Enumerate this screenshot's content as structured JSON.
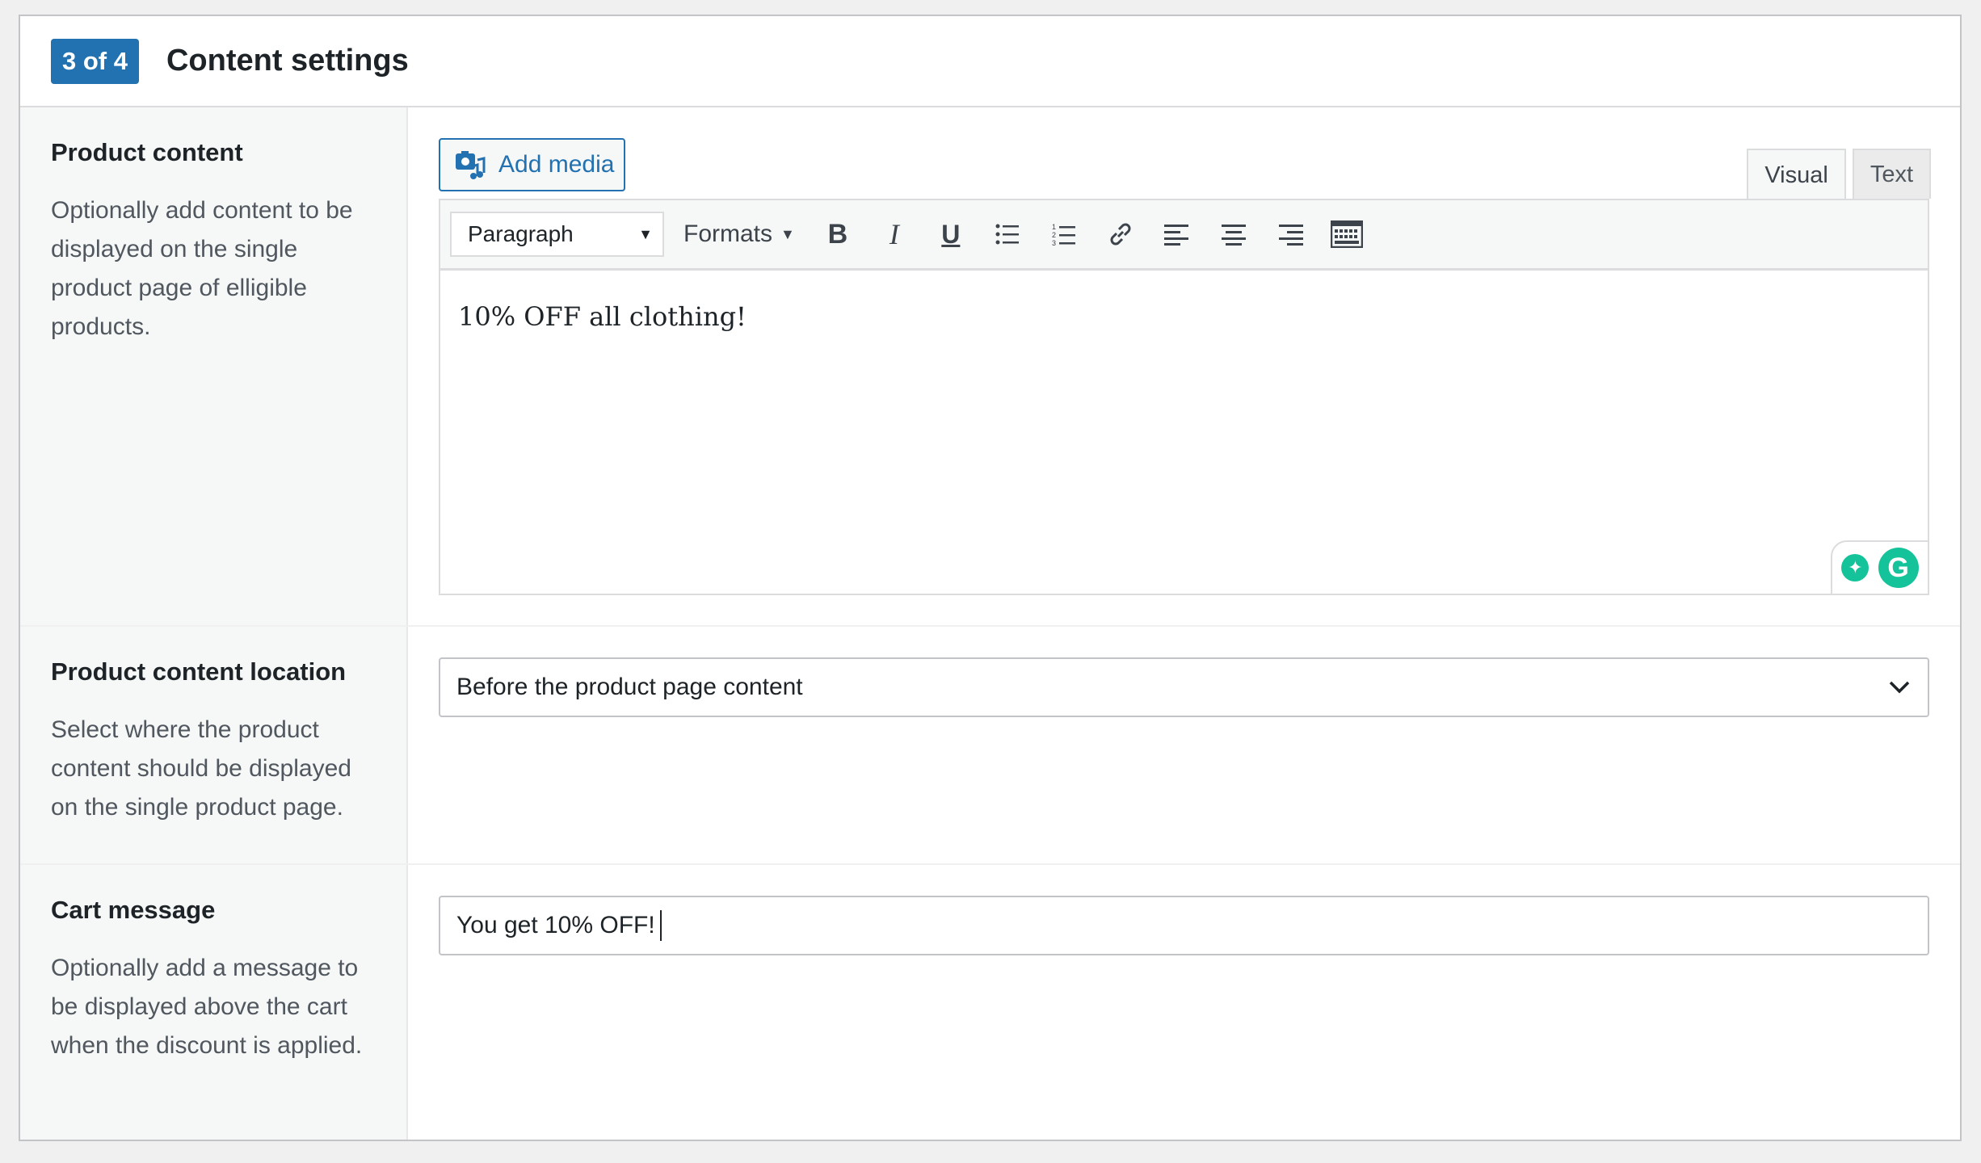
{
  "header": {
    "step_badge": "3 of 4",
    "title": "Content settings"
  },
  "product_content": {
    "label": "Product content",
    "description": "Optionally add content to be displayed on the single product page of elligible products.",
    "add_media_label": "Add media",
    "tabs": [
      {
        "label": "Visual",
        "active": true
      },
      {
        "label": "Text",
        "active": false
      }
    ],
    "toolbar": {
      "block_format": "Paragraph",
      "formats_label": "Formats",
      "buttons": [
        "bold-icon",
        "italic-icon",
        "underline-icon",
        "bullet-list-icon",
        "numbered-list-icon",
        "link-icon",
        "align-left-icon",
        "align-center-icon",
        "align-right-icon",
        "toolbar-toggle-icon"
      ]
    },
    "editor_text": "10% OFF all clothing!"
  },
  "product_content_location": {
    "label": "Product content location",
    "description": "Select where the product content should be displayed on the single product page.",
    "selected": "Before the product page content"
  },
  "cart_message": {
    "label": "Cart message",
    "description": "Optionally add a message to be displayed above the cart when the discount is applied.",
    "value": "You get 10% OFF!"
  },
  "colors": {
    "accent": "#2271b1",
    "grammarly": "#15c39a"
  }
}
